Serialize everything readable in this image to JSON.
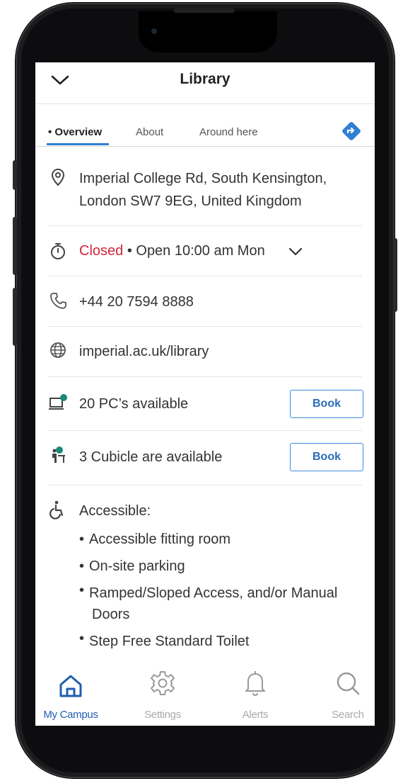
{
  "header": {
    "title": "Library"
  },
  "tabs": [
    {
      "label": "• Overview",
      "active": true
    },
    {
      "label": "About",
      "active": false
    },
    {
      "label": "Around here",
      "active": false
    }
  ],
  "details": {
    "address_line1": "Imperial College Rd, South Kensington,",
    "address_line2": "London SW7 9EG, United Kingdom",
    "hours_status": "Closed",
    "hours_next": " • Open 10:00 am Mon",
    "phone": "+44 20 7594 8888",
    "website": "imperial.ac.uk/library",
    "pcs": "20 PC’s available",
    "cubicles": "3 Cubicle are available",
    "book_label": "Book",
    "accessible_heading": "Accessible:",
    "accessible_items": [
      "Accessible fitting room",
      "On-site parking",
      "Ramped/Sloped Access, and/or Manual",
      "Doors",
      "Step Free Standard Toilet"
    ]
  },
  "bottom_nav": [
    {
      "label": "My Campus",
      "icon": "home-icon",
      "active": true
    },
    {
      "label": "Settings",
      "icon": "gear-icon",
      "active": false
    },
    {
      "label": "Alerts",
      "icon": "bell-icon",
      "active": false
    },
    {
      "label": "Search",
      "icon": "search-icon",
      "active": false
    }
  ],
  "colors": {
    "accent": "#2f7fd3",
    "closed": "#d0263a",
    "available_dot": "#1a8a78",
    "nav_active": "#1f5fae"
  }
}
